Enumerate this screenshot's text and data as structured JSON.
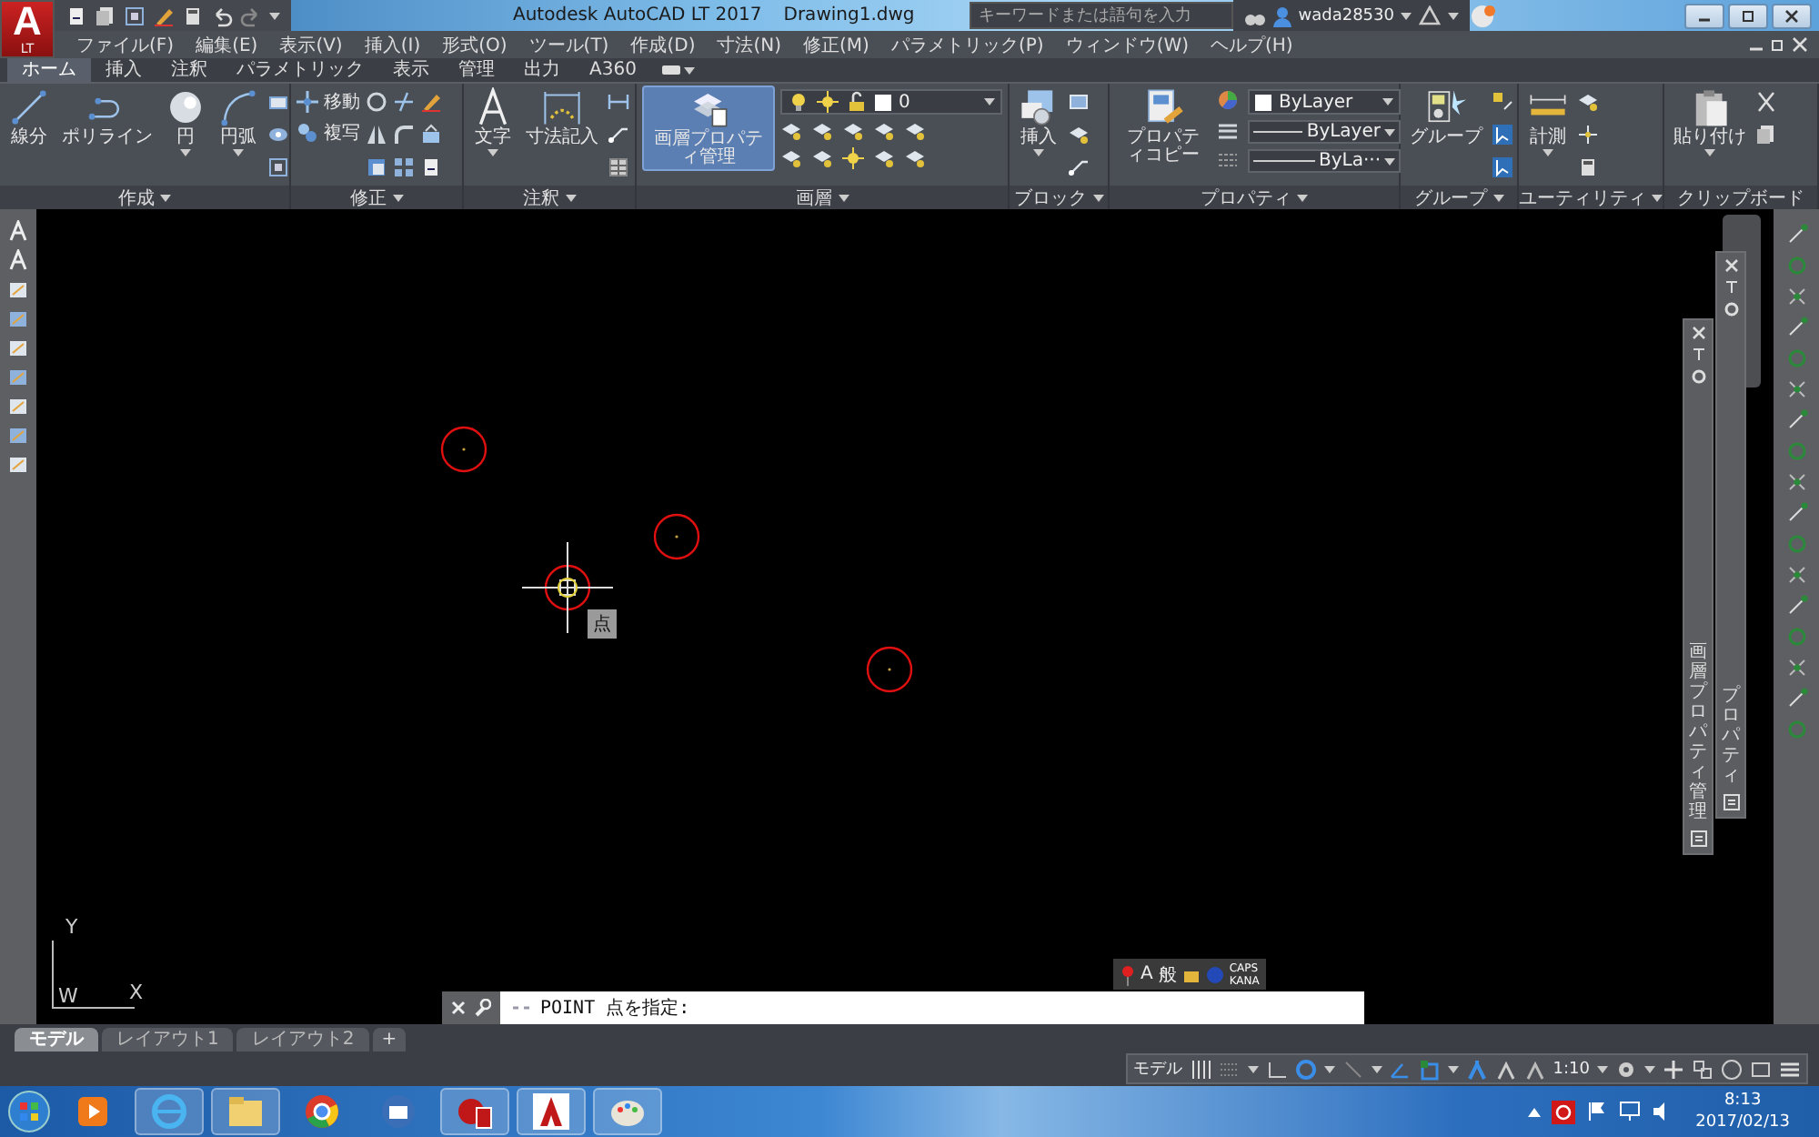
{
  "title_bar": {
    "logo": "A",
    "edition": "LT",
    "title": "Autodesk AutoCAD LT 2017",
    "file_name": "Drawing1.dwg",
    "search": {
      "placeholder": "キーワードまたは語句を入力"
    },
    "user": "wada28530"
  },
  "menu_bar": [
    "ファイル(F)",
    "編集(E)",
    "表示(V)",
    "挿入(I)",
    "形式(O)",
    "ツール(T)",
    "作成(D)",
    "寸法(N)",
    "修正(M)",
    "パラメトリック(P)",
    "ウィンドウ(W)",
    "ヘルプ(H)"
  ],
  "ribbon_tabs": [
    {
      "label": "ホーム",
      "selected": true
    },
    {
      "label": "挿入",
      "selected": false
    },
    {
      "label": "注釈",
      "selected": false
    },
    {
      "label": "パラメトリック",
      "selected": false
    },
    {
      "label": "表示",
      "selected": false
    },
    {
      "label": "管理",
      "selected": false
    },
    {
      "label": "出力",
      "selected": false
    },
    {
      "label": "A360",
      "selected": false
    }
  ],
  "ribbon_panels": [
    {
      "title": "作成",
      "menu": true,
      "tools": [
        {
          "kind": "large",
          "label": "線分",
          "dropdown": false,
          "highlighted": false
        },
        {
          "kind": "large",
          "label": "ポリライン",
          "dropdown": false,
          "highlighted": false
        },
        {
          "kind": "large",
          "label": "円",
          "dropdown": true,
          "highlighted": false
        },
        {
          "kind": "large",
          "label": "円弧",
          "dropdown": true,
          "highlighted": false
        }
      ]
    },
    {
      "title": "修正",
      "menu": true,
      "tools": [
        {
          "kind": "stack",
          "items": [
            {
              "kind": "small",
              "label": "移動"
            },
            {
              "kind": "small",
              "label": "複写"
            }
          ]
        }
      ]
    },
    {
      "title": "注釈",
      "menu": true,
      "tools": [
        {
          "kind": "large",
          "label": "文字",
          "dropdown": true,
          "highlighted": false
        },
        {
          "kind": "large",
          "label": "寸法記入",
          "dropdown": false,
          "highlighted": false
        }
      ]
    },
    {
      "title": "画層",
      "menu": true,
      "tools": [
        {
          "kind": "large",
          "label": "画層プロパティ管理",
          "dropdown": false,
          "highlighted": true
        },
        {
          "kind": "stack",
          "items": [
            {
              "kind": "combo",
              "value": "0"
            }
          ]
        }
      ]
    },
    {
      "title": "ブロック",
      "menu": true,
      "tools": [
        {
          "kind": "large",
          "label": "挿入",
          "dropdown": true,
          "highlighted": false
        }
      ]
    },
    {
      "title": "プロパティ",
      "menu": true,
      "tools": [
        {
          "kind": "large",
          "label": "プロパティコピー",
          "dropdown": false,
          "highlighted": false
        },
        {
          "kind": "stack",
          "items": [
            {
              "kind": "combo",
              "value": "ByLayer"
            },
            {
              "kind": "linetype",
              "value": "ByLayer"
            },
            {
              "kind": "linetype",
              "value": "ByLa···"
            }
          ]
        }
      ]
    },
    {
      "title": "グループ",
      "menu": true,
      "tools": [
        {
          "kind": "large",
          "label": "グループ",
          "dropdown": false,
          "highlighted": false
        }
      ]
    },
    {
      "title": "ユーティリティ",
      "menu": true,
      "tools": [
        {
          "kind": "large",
          "label": "計測",
          "dropdown": true,
          "highlighted": false
        }
      ]
    },
    {
      "title": "クリップボード",
      "menu": false,
      "tools": [
        {
          "kind": "large",
          "label": "貼り付け",
          "dropdown": true,
          "highlighted": false
        }
      ]
    }
  ],
  "drawing": {
    "cursor_tooltip": "点",
    "ucs": {
      "y": "Y",
      "w": "W",
      "x": "X"
    }
  },
  "palettes": [
    {
      "title": "画層プロパティ管理"
    },
    {
      "title": "プロパティ"
    }
  ],
  "command_line": {
    "prompt": "POINT 点を指定:"
  },
  "ime_bar": {
    "mode": "A",
    "input": "般",
    "caps": "CAPS",
    "kana": "KANA"
  },
  "layout_tabs": [
    {
      "label": "モデル",
      "selected": true
    },
    {
      "label": "レイアウト1",
      "selected": false
    },
    {
      "label": "レイアウト2",
      "selected": false
    }
  ],
  "add_layout": "+",
  "status_bar": {
    "space": "モデル",
    "scale": "1:10"
  },
  "taskbar": {
    "time": "8:13",
    "date": "2017/02/13"
  }
}
